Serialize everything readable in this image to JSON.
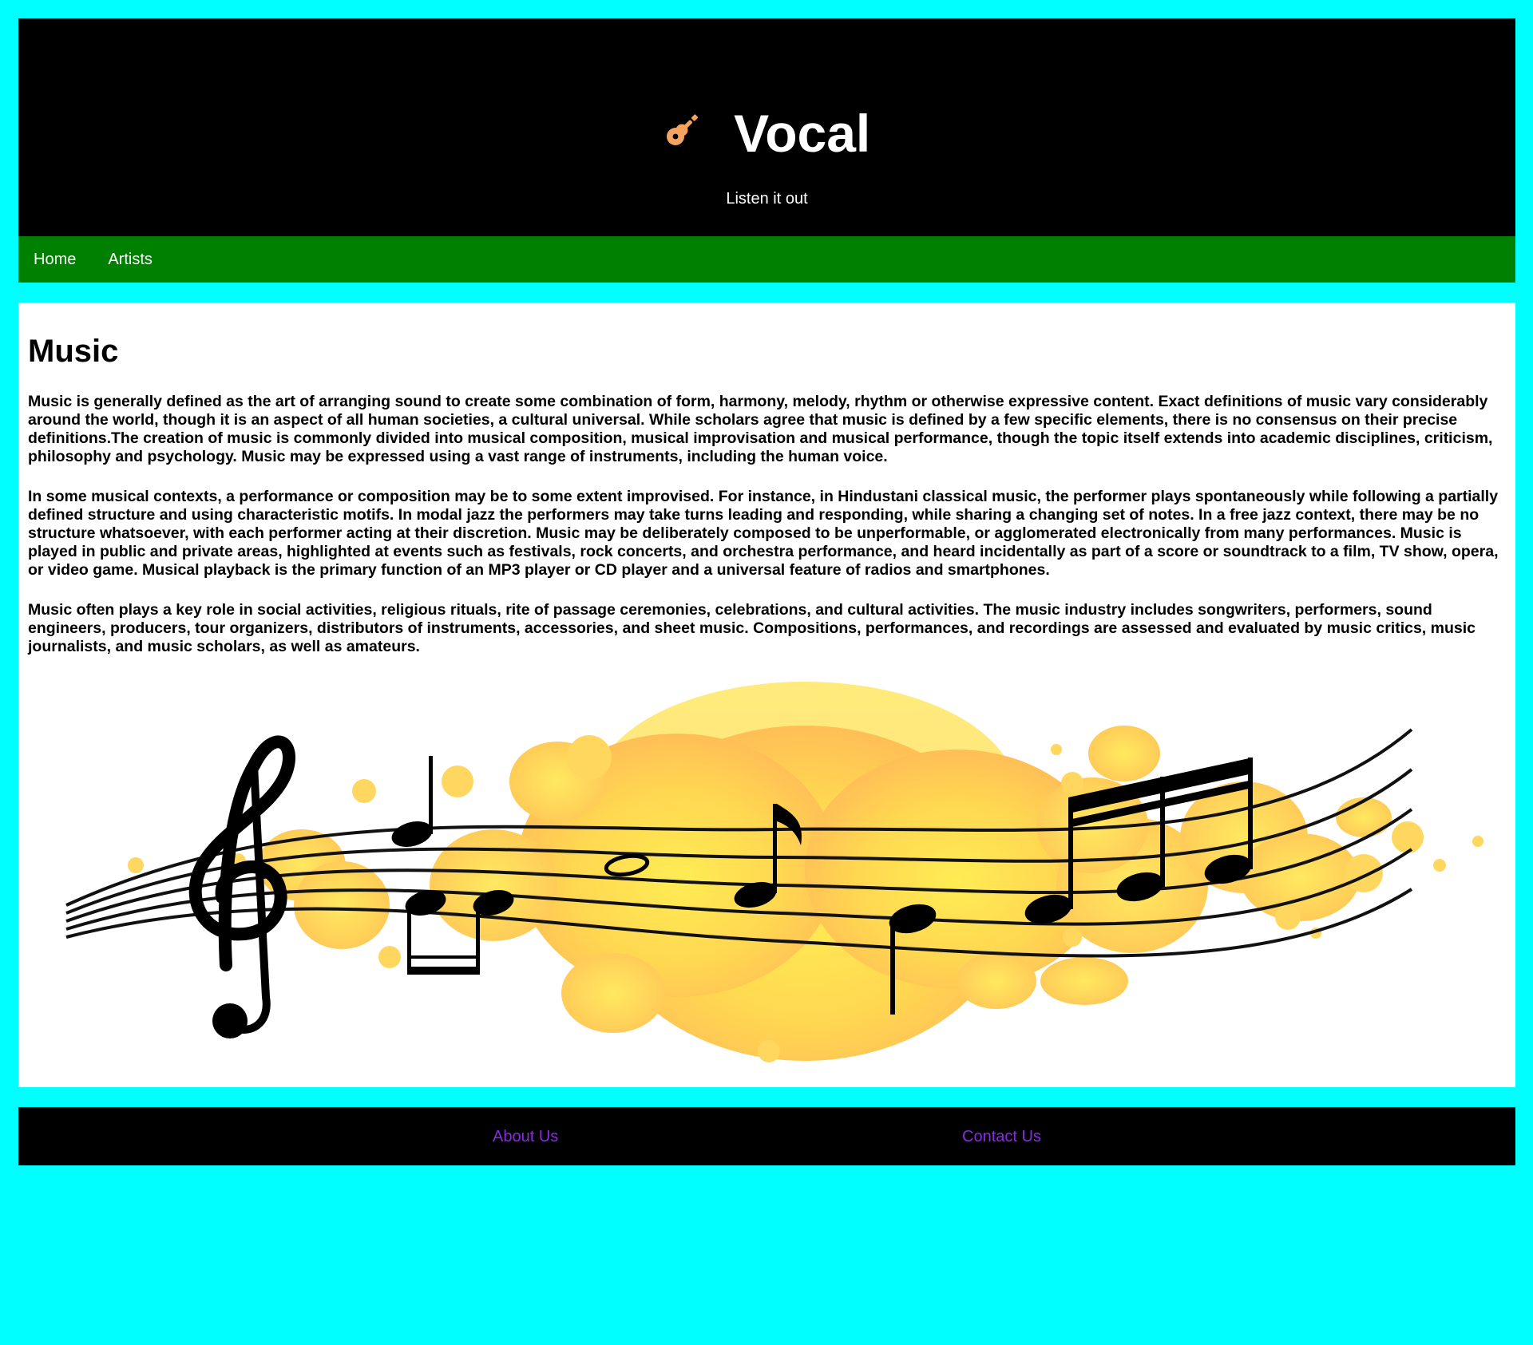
{
  "header": {
    "brand_name": "Vocal",
    "logo_icon": "guitar-icon",
    "tagline": "Listen it out"
  },
  "nav": {
    "items": [
      {
        "label": "Home"
      },
      {
        "label": "Artists"
      }
    ]
  },
  "main": {
    "title": "Music",
    "paragraphs": [
      "Music is generally defined as the art of arranging sound to create some combination of form, harmony, melody, rhythm or otherwise expressive content. Exact definitions of music vary considerably around the world, though it is an aspect of all human societies, a cultural universal. While scholars agree that music is defined by a few specific elements, there is no consensus on their precise definitions.The creation of music is commonly divided into musical composition, musical improvisation and musical performance, though the topic itself extends into academic disciplines, criticism, philosophy and psychology. Music may be expressed using a vast range of instruments, including the human voice.",
      "In some musical contexts, a performance or composition may be to some extent improvised. For instance, in Hindustani classical music, the performer plays spontaneously while following a partially defined structure and using characteristic motifs. In modal jazz the performers may take turns leading and responding, while sharing a changing set of notes. In a free jazz context, there may be no structure whatsoever, with each performer acting at their discretion. Music may be deliberately composed to be unperformable, or agglomerated electronically from many performances. Music is played in public and private areas, highlighted at events such as festivals, rock concerts, and orchestra performance, and heard incidentally as part of a score or soundtrack to a film, TV show, opera, or video game. Musical playback is the primary function of an MP3 player or CD player and a universal feature of radios and smartphones.",
      "Music often plays a key role in social activities, religious rituals, rite of passage ceremonies, celebrations, and cultural activities. The music industry includes songwriters, performers, sound engineers, producers, tour organizers, distributors of instruments, accessories, and sheet music. Compositions, performances, and recordings are assessed and evaluated by music critics, music journalists, and music scholars, as well as amateurs."
    ]
  },
  "footer": {
    "links": [
      {
        "label": "About Us"
      },
      {
        "label": "Contact Us"
      }
    ]
  },
  "colors": {
    "page_background": "#00ffff",
    "header_background": "#000000",
    "nav_background": "#008000",
    "footer_link": "#8a2be2",
    "logo": "#f4a460"
  }
}
